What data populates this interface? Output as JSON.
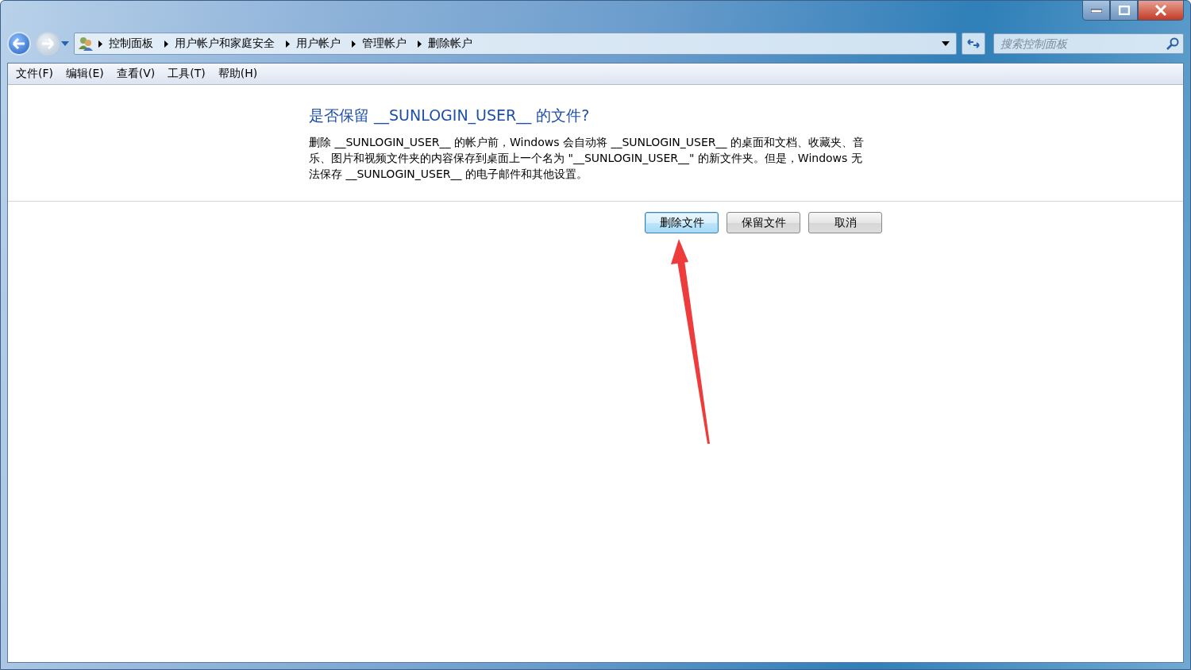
{
  "address_bar": {
    "breadcrumbs": [
      "控制面板",
      "用户帐户和家庭安全",
      "用户帐户",
      "管理帐户",
      "删除帐户"
    ]
  },
  "search": {
    "placeholder": "搜索控制面板"
  },
  "menu": [
    "文件(F)",
    "编辑(E)",
    "查看(V)",
    "工具(T)",
    "帮助(H)"
  ],
  "dialog": {
    "heading": "是否保留 __SUNLOGIN_USER__ 的文件?",
    "body": "删除 __SUNLOGIN_USER__ 的帐户前，Windows 会自动将 __SUNLOGIN_USER__ 的桌面和文档、收藏夹、音乐、图片和视频文件夹的内容保存到桌面上一个名为 \"__SUNLOGIN_USER__\" 的新文件夹。但是，Windows 无法保存 __SUNLOGIN_USER__ 的电子邮件和其他设置。",
    "buttons": [
      {
        "label": "删除文件",
        "focused": true
      },
      {
        "label": "保留文件",
        "focused": false
      },
      {
        "label": "取消",
        "focused": false
      }
    ]
  }
}
